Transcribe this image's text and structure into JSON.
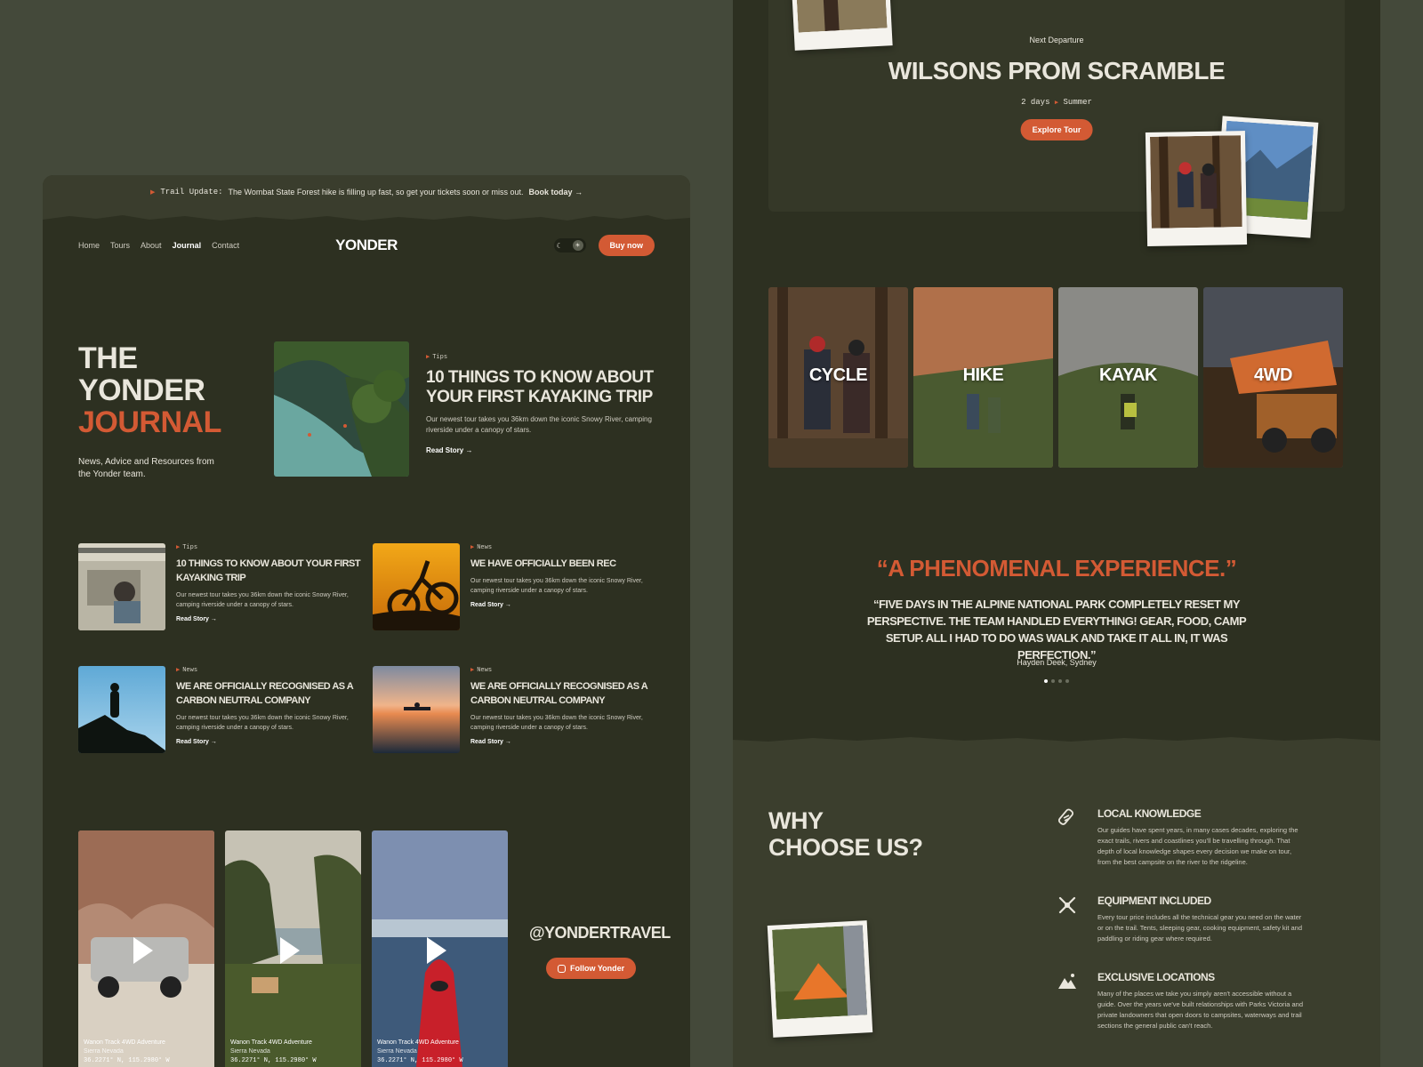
{
  "colors": {
    "accent": "#d35a34",
    "panel": "#2d3021",
    "background": "#44493a"
  },
  "journal": {
    "trail_update": {
      "label": "Trail Update:",
      "message": "The Wombat State Forest hike is filling up fast, so get your tickets soon or miss out.",
      "link": "Book today"
    },
    "nav": {
      "links": [
        "Home",
        "Tours",
        "About",
        "Journal",
        "Contact"
      ],
      "active": "Journal",
      "logo": "YONDER",
      "buy_label": "Buy now"
    },
    "hero": {
      "title_line1": "The",
      "title_line2": "Yonder",
      "title_line3": "Journal",
      "subtitle": "News, Advice and Resources from the Yonder team.",
      "featured": {
        "tag": "Tips",
        "title": "10 things to know about your first kayaking trip",
        "excerpt": "Our newest tour takes you 36km down the iconic Snowy River, camping riverside under a canopy of stars.",
        "read_label": "Read Story"
      }
    },
    "articles": [
      {
        "tag": "Tips",
        "title": "10 things to know about your first kayaking trip",
        "excerpt": "Our newest tour takes you 36km down the iconic Snowy River, camping riverside under a canopy of stars.",
        "read_label": "Read Story"
      },
      {
        "tag": "News",
        "title": "We have officially been rec",
        "excerpt": "Our newest tour takes you 36km down the iconic Snowy River, camping riverside under a canopy of stars.",
        "read_label": "Read Story"
      },
      {
        "tag": "News",
        "title": "We are officially recognised as a carbon neutral company",
        "excerpt": "Our newest tour takes you 36km down the iconic Snowy River, camping riverside under a canopy of stars.",
        "read_label": "Read Story"
      },
      {
        "tag": "News",
        "title": "We are officially recognised as a carbon neutral company",
        "excerpt": "Our newest tour takes you 36km down the iconic Snowy River, camping riverside under a canopy of stars.",
        "read_label": "Read Story"
      }
    ],
    "videos": [
      {
        "title": "Wanon Track 4WD Adventure",
        "location": "Sierra Nevada",
        "coords": "36.2271° N, 115.2980° W"
      },
      {
        "title": "Wanon Track 4WD Adventure",
        "location": "Sierra Nevada",
        "coords": "36.2271° N, 115.2980° W"
      },
      {
        "title": "Wanon Track 4WD Adventure",
        "location": "Sierra Nevada",
        "coords": "36.2271° N, 115.2980° W"
      }
    ],
    "instagram": {
      "handle": "@YONDERTRAVEL",
      "follow_label": "Follow Yonder"
    }
  },
  "home": {
    "departure": {
      "label": "Next Departure",
      "title": "Wilsons Prom Scramble",
      "duration": "2 days",
      "season": "Summer",
      "button": "Explore Tour"
    },
    "activities": [
      "Cycle",
      "Hike",
      "Kayak",
      "4WD"
    ],
    "testimonial": {
      "headline": "“A phenomenal experience.”",
      "quote": "“Five days in the Alpine National Park completely reset my perspective. The team handled everything! Gear, food, camp setup. All I had to do was walk and take it all in, it was perfection.”",
      "author": "Hayden Deek, Sydney",
      "slides": 4,
      "active_slide": 1
    },
    "why": {
      "title_line1": "Why",
      "title_line2": "choose us?",
      "features": [
        {
          "icon": "compass-icon",
          "title": "Local Knowledge",
          "text": "Our guides have spent years, in many cases decades, exploring the exact trails, rivers and coastlines you'll be travelling through. That depth of local knowledge shapes every decision we make on tour, from the best campsite on the river to the ridgeline."
        },
        {
          "icon": "tools-icon",
          "title": "Equipment Included",
          "text": "Every tour price includes all the technical gear you need on the water or on the trail. Tents, sleeping gear, cooking equipment, safety kit and paddling or riding gear where required."
        },
        {
          "icon": "mountain-icon",
          "title": "Exclusive Locations",
          "text": "Many of the places we take you simply aren't accessible without a guide. Over the years we've built relationships with Parks Victoria and private landowners that open doors to campsites, waterways and trail sections the general public can't reach."
        }
      ]
    }
  }
}
